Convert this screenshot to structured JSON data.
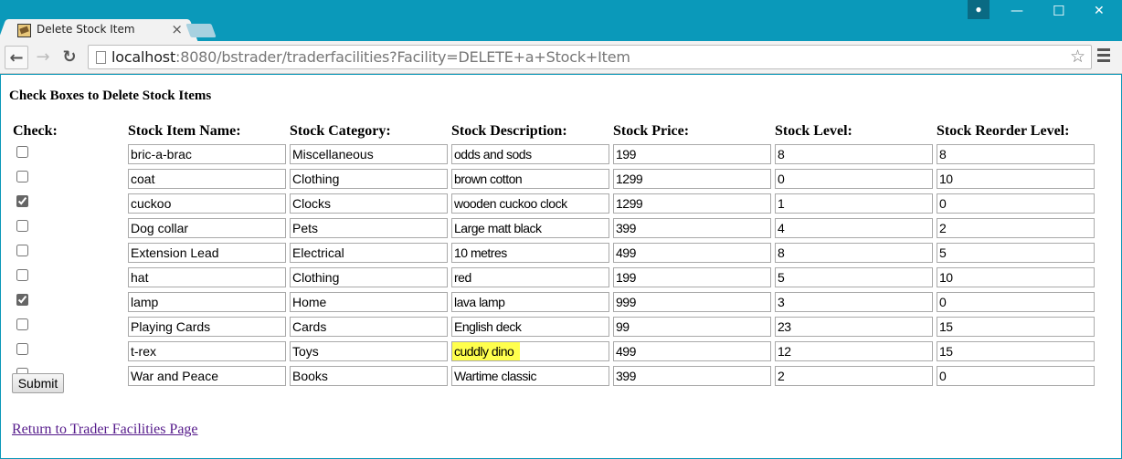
{
  "browser": {
    "tab_title": "Delete Stock Item",
    "tab_close": "×",
    "url_host": "localhost",
    "url_rest": ":8080/bstrader/traderfacilities?Facility=DELETE+a+Stock+Item",
    "icons": {
      "back": "←",
      "forward": "→",
      "reload": "↻",
      "star": "☆",
      "profile": "👤",
      "minimize": "—",
      "maximize": "☐",
      "close": "✕"
    }
  },
  "page": {
    "heading": "Check Boxes to Delete Stock Items",
    "columns": [
      "Check:",
      "Stock Item Name:",
      "Stock Category:",
      "Stock Description:",
      "Stock Price:",
      "Stock Level:",
      "Stock Reorder Level:"
    ],
    "rows": [
      {
        "checked": false,
        "name": "bric-a-brac",
        "category": "Miscellaneous",
        "description": "odds and sods",
        "price": "199",
        "level": "8",
        "reorder": "8"
      },
      {
        "checked": false,
        "name": "coat",
        "category": "Clothing",
        "description": "brown cotton",
        "price": "1299",
        "level": "0",
        "reorder": "10"
      },
      {
        "checked": true,
        "name": "cuckoo",
        "category": "Clocks",
        "description": "wooden cuckoo clock",
        "price": "1299",
        "level": "1",
        "reorder": "0"
      },
      {
        "checked": false,
        "name": "Dog collar",
        "category": "Pets",
        "description": "Large matt black",
        "price": "399",
        "level": "4",
        "reorder": "2"
      },
      {
        "checked": false,
        "name": "Extension Lead",
        "category": "Electrical",
        "description": "10 metres",
        "price": "499",
        "level": "8",
        "reorder": "5"
      },
      {
        "checked": false,
        "name": "hat",
        "category": "Clothing",
        "description": "red",
        "price": "199",
        "level": "5",
        "reorder": "10"
      },
      {
        "checked": true,
        "name": "lamp",
        "category": "Home",
        "description": "lava lamp",
        "price": "999",
        "level": "3",
        "reorder": "0"
      },
      {
        "checked": false,
        "name": "Playing Cards",
        "category": "Cards",
        "description": "English deck",
        "price": "99",
        "level": "23",
        "reorder": "15"
      },
      {
        "checked": false,
        "name": "t-rex",
        "category": "Toys",
        "description": "cuddly dino",
        "price": "499",
        "level": "12",
        "reorder": "15",
        "highlight": "#ffff4d"
      },
      {
        "checked": false,
        "name": "War and Peace",
        "category": "Books",
        "description": "Wartime classic",
        "price": "399",
        "level": "2",
        "reorder": "0"
      }
    ],
    "submit_label": "Submit",
    "return_link": "Return to Trader Facilities Page"
  }
}
